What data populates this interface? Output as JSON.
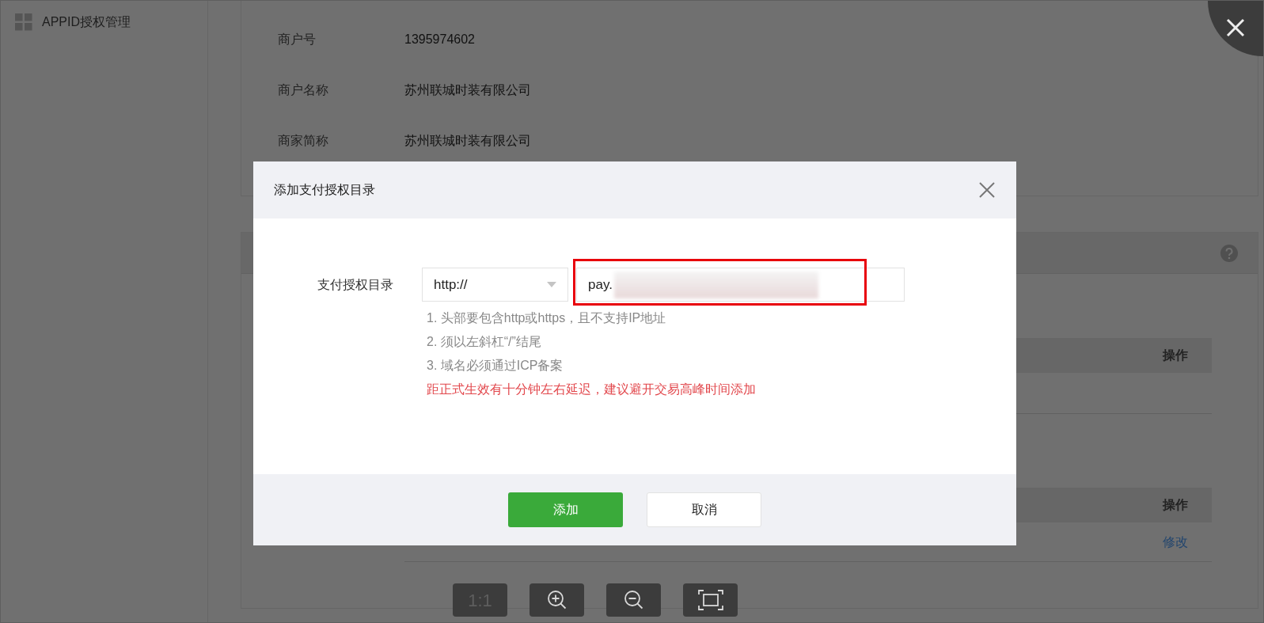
{
  "sidebar": {
    "items": [
      {
        "label": "APPID授权管理",
        "selected": true
      }
    ]
  },
  "merchant_info": [
    {
      "label": "商户号",
      "value": "1395974602"
    },
    {
      "label": "商户名称",
      "value": "苏州联城时装有限公司"
    },
    {
      "label": "商家简称",
      "value": "苏州联城时装有限公司"
    }
  ],
  "tables": [
    {
      "column_last": "操作"
    },
    {
      "column_last": "操作",
      "rows": [
        {
          "action": "修改"
        }
      ]
    }
  ],
  "dialog": {
    "title": "添加支付授权目录",
    "field_label": "支付授权目录",
    "scheme": {
      "value": "http://"
    },
    "url": {
      "value": "pay.",
      "redacted": true,
      "highlighted": true
    },
    "hints": [
      {
        "text": "1. 头部要包含http或https，且不支持IP地址",
        "kind": "note"
      },
      {
        "text": "2. 须以左斜杠“/”结尾",
        "kind": "note"
      },
      {
        "text": "3. 域名必须通过ICP备案",
        "kind": "note"
      },
      {
        "text": "距正式生效有十分钟左右延迟，建议避开交易高峰时间添加",
        "kind": "warning"
      }
    ],
    "buttons": [
      {
        "label": "添加",
        "kind": "primary"
      },
      {
        "label": "取消",
        "kind": "secondary"
      }
    ]
  },
  "viewer_toolbar": [
    {
      "kind": "actual-size",
      "label": "1:1"
    },
    {
      "kind": "zoom-in"
    },
    {
      "kind": "zoom-out"
    },
    {
      "kind": "fit"
    }
  ]
}
